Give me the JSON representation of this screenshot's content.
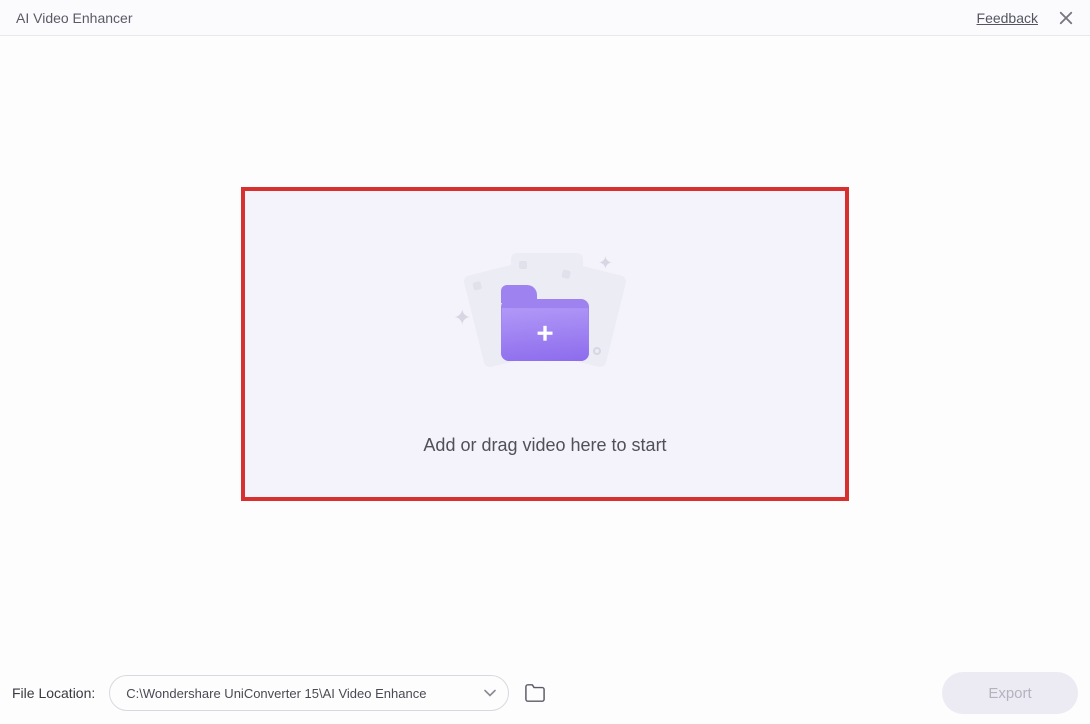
{
  "header": {
    "title": "AI Video Enhancer",
    "feedback": "Feedback"
  },
  "dropzone": {
    "prompt": "Add or drag video here to start"
  },
  "footer": {
    "file_location_label": "File Location:",
    "path": "C:\\Wondershare UniConverter 15\\AI Video Enhance",
    "export_label": "Export"
  },
  "colors": {
    "highlight_border": "#d82f2f",
    "folder_primary": "#8d6ced",
    "dropzone_bg": "#f4f3fb"
  }
}
